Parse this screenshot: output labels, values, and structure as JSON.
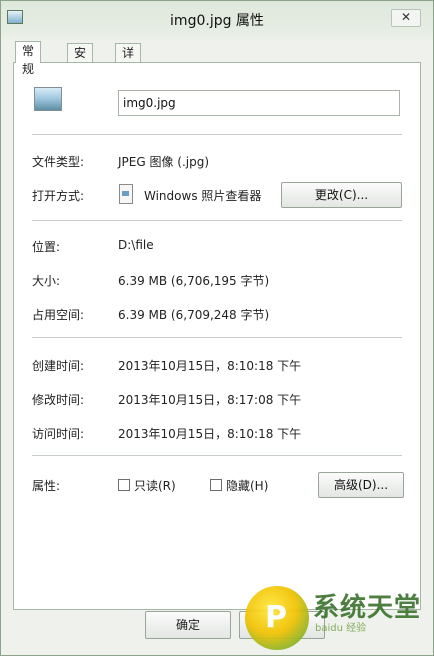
{
  "window": {
    "title": "img0.jpg 属性",
    "close_label": "✕"
  },
  "tabs": [
    {
      "label": "常规"
    },
    {
      "label": "安全"
    },
    {
      "label": "详细信息"
    }
  ],
  "general": {
    "file_name": "img0.jpg",
    "file_type_label": "文件类型:",
    "file_type_value": "JPEG 图像 (.jpg)",
    "open_with_label": "打开方式:",
    "open_with_value": "Windows 照片查看器",
    "change_button": "更改(C)...",
    "location_label": "位置:",
    "location_value": "D:\\file",
    "size_label": "大小:",
    "size_value": "6.39 MB (6,706,195 字节)",
    "size_on_disk_label": "占用空间:",
    "size_on_disk_value": "6.39 MB (6,709,248 字节)",
    "created_label": "创建时间:",
    "created_value": "2013年10月15日，8:10:18 下午",
    "modified_label": "修改时间:",
    "modified_value": "2013年10月15日，8:17:08 下午",
    "accessed_label": "访问时间:",
    "accessed_value": "2013年10月15日，8:10:18 下午",
    "attributes_label": "属性:",
    "readonly_label": "只读(R)",
    "hidden_label": "隐藏(H)",
    "advanced_button": "高级(D)...",
    "readonly_checked": false,
    "hidden_checked": false
  },
  "footer": {
    "ok_button": "确定"
  },
  "watermark": {
    "logo_letter": "P",
    "text": "系统天堂",
    "url": "baidu 经验"
  },
  "icons": [
    "window-icon",
    "image-file-icon",
    "photo-viewer-icon",
    "close-icon"
  ]
}
